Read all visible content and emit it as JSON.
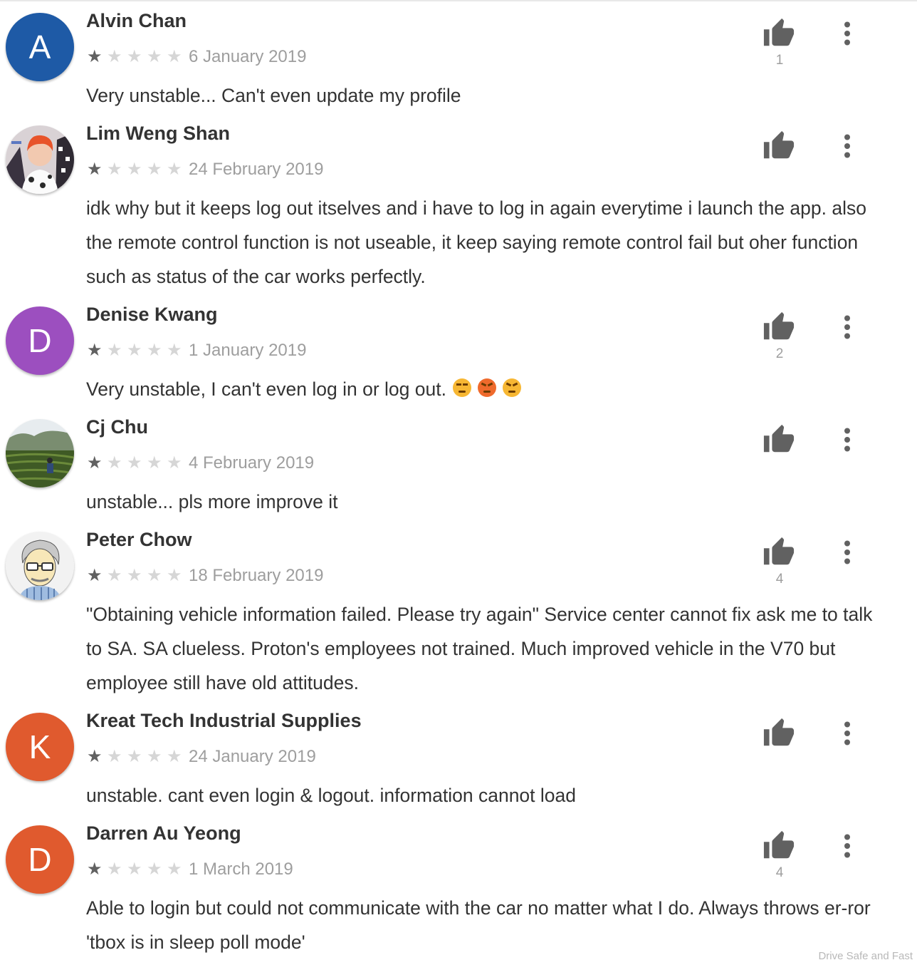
{
  "watermark": "Drive Safe and Fast",
  "reviews": [
    {
      "name": "Alvin Chan",
      "date": "6 January 2019",
      "rating": 1,
      "likes": "1",
      "text": "Very unstable... Can't even update my profile",
      "avatar": {
        "type": "letter",
        "letter": "A",
        "color": "#1e5aa6"
      }
    },
    {
      "name": "Lim Weng Shan",
      "date": "24 February 2019",
      "rating": 1,
      "likes": "",
      "text": "idk why but it keeps log out itselves and i have to log in again everytime i launch the app. also the remote control function is not useable, it keep saying remote control fail but oher function such as status of the car works perfectly.",
      "avatar": {
        "type": "photo",
        "kind": "portrait"
      }
    },
    {
      "name": "Denise Kwang",
      "date": "1 January 2019",
      "rating": 1,
      "likes": "2",
      "text": "Very unstable, I can't even log in or log out.",
      "emojis": [
        "unamused-face",
        "pouting-face",
        "angry-face"
      ],
      "avatar": {
        "type": "letter",
        "letter": "D",
        "color": "#9c4fbf"
      }
    },
    {
      "name": "Cj Chu",
      "date": "4 February 2019",
      "rating": 1,
      "likes": "",
      "text": "unstable... pls more improve it",
      "avatar": {
        "type": "photo",
        "kind": "landscape"
      }
    },
    {
      "name": "Peter Chow",
      "date": "18 February 2019",
      "rating": 1,
      "likes": "4",
      "text": "\"Obtaining vehicle information failed. Please try again\" Service center cannot fix ask me to talk to SA. SA clueless. Proton's employees not trained. Much improved vehicle in the V70 but employee still have old attitudes.",
      "avatar": {
        "type": "photo",
        "kind": "cartoon"
      }
    },
    {
      "name": "Kreat Tech Industrial Supplies",
      "date": "24 January 2019",
      "rating": 1,
      "likes": "",
      "text": "unstable. cant even login & logout. information cannot load",
      "avatar": {
        "type": "letter",
        "letter": "K",
        "color": "#e05a2e"
      }
    },
    {
      "name": "Darren Au Yeong",
      "date": "1 March 2019",
      "rating": 1,
      "likes": "4",
      "text": "Able to login but could not communicate with the car no matter what I do. Always throws er-ror 'tbox is in sleep poll mode'",
      "avatar": {
        "type": "letter",
        "letter": "D",
        "color": "#e05a2e"
      }
    }
  ]
}
